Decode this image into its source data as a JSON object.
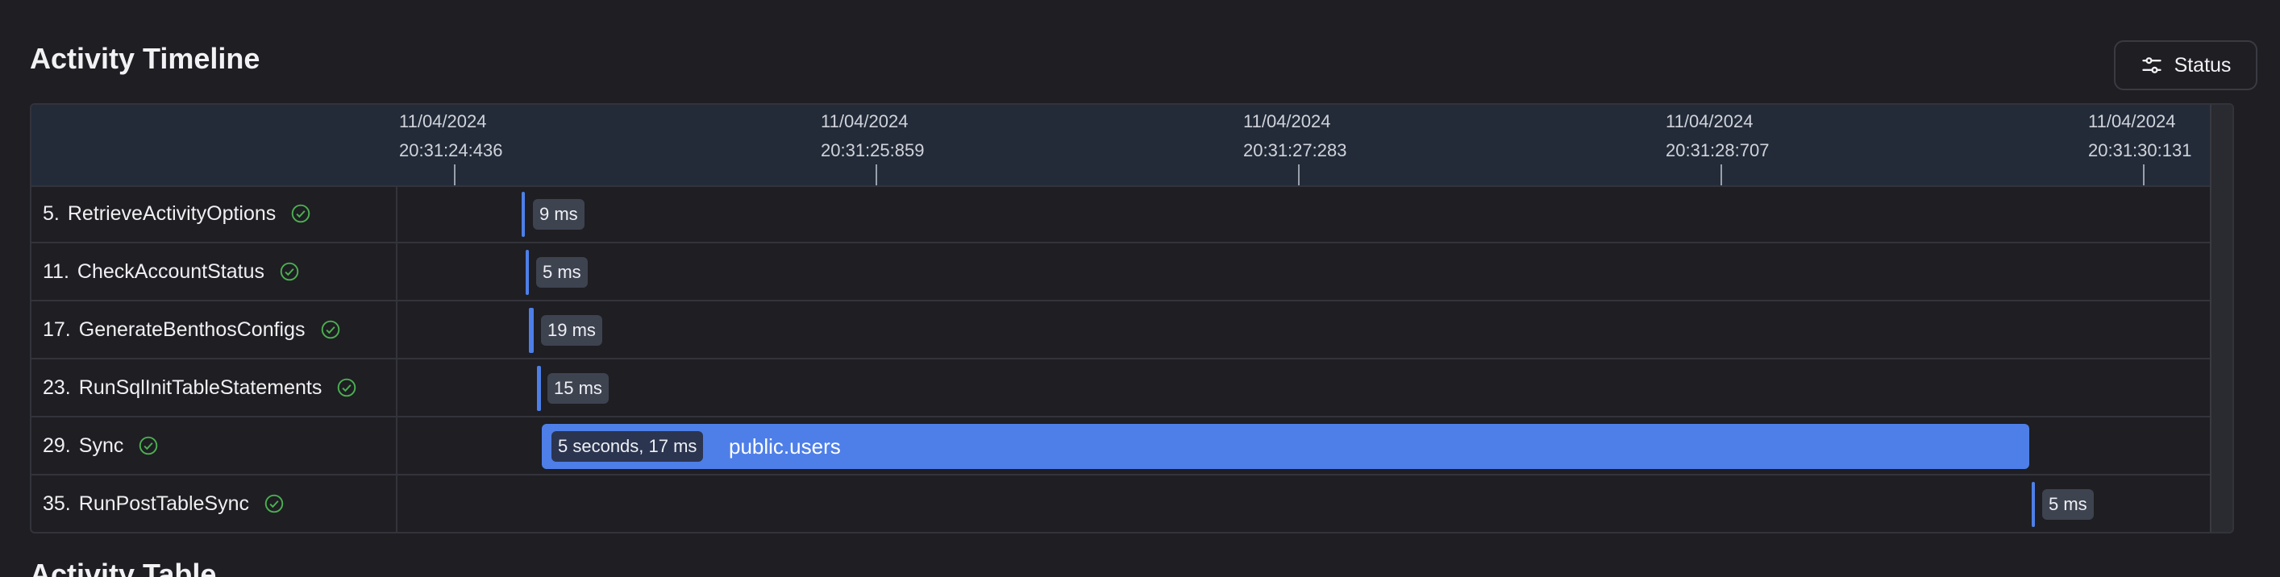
{
  "page": {
    "title": "Activity Timeline",
    "next_section_title": "Activity Table",
    "status_button": {
      "label": "Status",
      "icon": "sliders-icon"
    }
  },
  "timeline": {
    "ticks": [
      {
        "date": "11/04/2024",
        "time": "20:31:24:436"
      },
      {
        "date": "11/04/2024",
        "time": "20:31:25:859"
      },
      {
        "date": "11/04/2024",
        "time": "20:31:27:283"
      },
      {
        "date": "11/04/2024",
        "time": "20:31:28:707"
      },
      {
        "date": "11/04/2024",
        "time": "20:31:30:131"
      }
    ],
    "rows": [
      {
        "index": "5.",
        "name": "RetrieveActivityOptions",
        "status": "completed",
        "duration": "9 ms"
      },
      {
        "index": "11.",
        "name": "CheckAccountStatus",
        "status": "completed",
        "duration": "5 ms"
      },
      {
        "index": "17.",
        "name": "GenerateBenthosConfigs",
        "status": "completed",
        "duration": "19 ms"
      },
      {
        "index": "23.",
        "name": "RunSqlInitTableStatements",
        "status": "completed",
        "duration": "15 ms"
      },
      {
        "index": "29.",
        "name": "Sync",
        "status": "completed",
        "duration": "5 seconds, 17 ms",
        "bar_label": "public.users"
      },
      {
        "index": "35.",
        "name": "RunPostTableSync",
        "status": "completed",
        "duration": "5 ms"
      }
    ]
  },
  "colors": {
    "background": "#1e1e23",
    "header": "#232b39",
    "bar": "#4e7fe8",
    "success": "#4caf50"
  }
}
